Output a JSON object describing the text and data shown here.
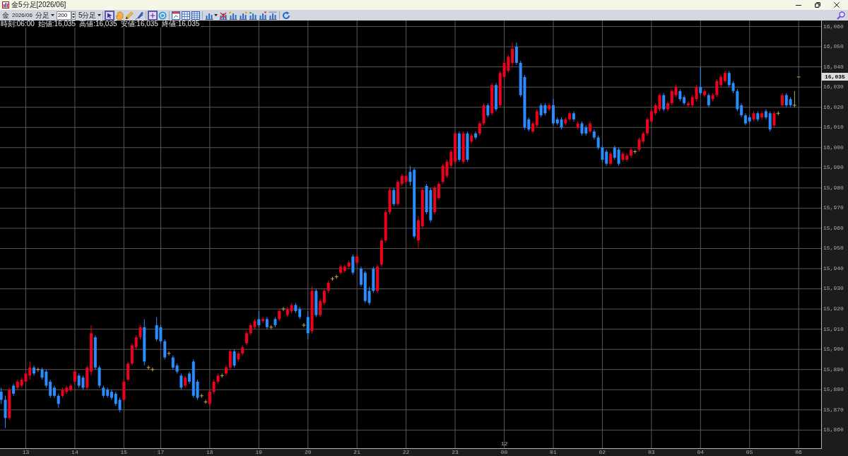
{
  "window": {
    "title": "金5分足[2026/06]"
  },
  "toolbar": {
    "symbol": "金",
    "contract": "2026/06",
    "bar_unit": "分足",
    "bar_count": "200",
    "period": "5分足",
    "tool_groups": [
      [
        {
          "kind": "pointer",
          "selected": true
        },
        {
          "kind": "hand",
          "selected": false
        },
        {
          "kind": "pencil",
          "selected": false
        },
        {
          "kind": "pen",
          "selected": false
        }
      ],
      [
        {
          "kind": "crosshair",
          "selected": true
        },
        {
          "kind": "disc",
          "selected": false
        }
      ],
      [
        {
          "kind": "window",
          "selected": false
        },
        {
          "kind": "table",
          "selected": false
        },
        {
          "kind": "grid",
          "selected": false
        }
      ],
      [
        {
          "kind": "barsmenu",
          "selected": false
        },
        {
          "kind": "barsdelete",
          "selected": false
        },
        {
          "kind": "barsleft",
          "selected": false
        },
        {
          "kind": "barsright",
          "selected": false
        },
        {
          "kind": "barsup",
          "selected": false
        },
        {
          "kind": "barsdown",
          "selected": false
        },
        {
          "kind": "barswide",
          "selected": false
        }
      ],
      [
        {
          "kind": "refresh",
          "selected": false
        }
      ]
    ]
  },
  "chart": {
    "readout": [
      "時刻:06:00",
      "始値:16,035",
      "高値:16,035",
      "安値:16,035",
      "終値:16,035"
    ],
    "current_price": "16,035",
    "chart_data": {
      "type": "candlestick",
      "grid": true,
      "categories": [
        null,
        null,
        null,
        null,
        null,
        null,
        "13",
        null,
        null,
        null,
        null,
        null,
        null,
        null,
        null,
        null,
        null,
        null,
        "14",
        null,
        null,
        null,
        null,
        null,
        null,
        null,
        null,
        null,
        null,
        null,
        "15",
        null,
        null,
        null,
        null,
        null,
        null,
        null,
        null,
        "17",
        null,
        null,
        null,
        null,
        null,
        null,
        null,
        null,
        null,
        null,
        null,
        "18",
        null,
        null,
        null,
        null,
        null,
        null,
        null,
        null,
        null,
        null,
        null,
        "19",
        null,
        null,
        null,
        null,
        null,
        null,
        null,
        null,
        null,
        null,
        null,
        "20",
        null,
        null,
        null,
        null,
        null,
        null,
        null,
        null,
        null,
        null,
        null,
        "21",
        null,
        null,
        null,
        null,
        null,
        null,
        null,
        null,
        null,
        null,
        null,
        "22",
        null,
        null,
        null,
        null,
        null,
        null,
        null,
        null,
        null,
        null,
        null,
        "23",
        null,
        null,
        null,
        null,
        null,
        null,
        null,
        null,
        null,
        null,
        null,
        "00",
        null,
        null,
        null,
        null,
        null,
        null,
        null,
        null,
        null,
        null,
        null,
        "01",
        null,
        null,
        null,
        null,
        null,
        null,
        null,
        null,
        null,
        null,
        null,
        "02",
        null,
        null,
        null,
        null,
        null,
        null,
        null,
        null,
        null,
        null,
        null,
        "03",
        null,
        null,
        null,
        null,
        null,
        null,
        null,
        null,
        null,
        null,
        null,
        "04",
        null,
        null,
        null,
        null,
        null,
        null,
        null,
        null,
        null,
        null,
        null,
        "05",
        null,
        null,
        null,
        null,
        null,
        null,
        null,
        null,
        null,
        null,
        null,
        "06"
      ],
      "ohlc": [
        [
          15879,
          15881,
          15873,
          15875
        ],
        [
          15875,
          15877,
          15861,
          15866
        ],
        [
          15866,
          15881,
          15865,
          15880
        ],
        [
          15882,
          15883,
          15877,
          15878
        ],
        [
          15881,
          15885,
          15880,
          15884
        ],
        [
          15882,
          15886,
          15881,
          15885
        ],
        [
          15884,
          15889,
          15883,
          15888
        ],
        [
          15887,
          15894,
          15885,
          15891
        ],
        [
          15891,
          15892,
          15887,
          15888
        ],
        [
          15890,
          15891,
          15889,
          15890
        ],
        [
          15890,
          15891,
          15885,
          15886
        ],
        [
          15889,
          15890,
          15881,
          15882
        ],
        [
          15884,
          15885,
          15876,
          15877
        ],
        [
          15881,
          15882,
          15876,
          15877
        ],
        [
          15877,
          15878,
          15871,
          15873
        ],
        [
          15877,
          15881,
          15876,
          15880
        ],
        [
          15879,
          15882,
          15878,
          15881
        ],
        [
          15880,
          15883,
          15879,
          15882
        ],
        [
          15884,
          15890,
          15883,
          15889
        ],
        [
          15887,
          15888,
          15881,
          15882
        ],
        [
          15886,
          15887,
          15880,
          15881
        ],
        [
          15881,
          15892,
          15880,
          15891
        ],
        [
          15889,
          15912,
          15887,
          15908
        ],
        [
          15906,
          15907,
          15890,
          15891
        ],
        [
          15891,
          15892,
          15881,
          15882
        ],
        [
          15881,
          15882,
          15876,
          15877
        ],
        [
          15880,
          15881,
          15876,
          15877
        ],
        [
          15879,
          15880,
          15875,
          15876
        ],
        [
          15878,
          15879,
          15872,
          15873
        ],
        [
          15875,
          15876,
          15869,
          15870
        ],
        [
          15875,
          15885,
          15874,
          15884
        ],
        [
          15885,
          15894,
          15884,
          15893
        ],
        [
          15893,
          15903,
          15892,
          15902
        ],
        [
          15901,
          15907,
          15900,
          15906
        ],
        [
          15906,
          15912,
          15905,
          15911
        ],
        [
          15911,
          15915,
          15892,
          15894
        ],
        [
          15891,
          15892,
          15890,
          15891
        ],
        [
          15890,
          15891,
          15889,
          15890
        ],
        [
          15912,
          15916,
          15904,
          15905
        ],
        [
          15911,
          15912,
          15903,
          15904
        ],
        [
          15904,
          15905,
          15895,
          15896
        ],
        [
          15898,
          15899,
          15897,
          15898
        ],
        [
          15896,
          15897,
          15890,
          15891
        ],
        [
          15892,
          15893,
          15888,
          15889
        ],
        [
          15887,
          15888,
          15880,
          15881
        ],
        [
          15882,
          15887,
          15881,
          15886
        ],
        [
          15888,
          15889,
          15883,
          15884
        ],
        [
          15894,
          15895,
          15876,
          15877
        ],
        [
          15884,
          15885,
          15875,
          15876
        ],
        [
          15877,
          15878,
          15876,
          15877
        ],
        [
          15874,
          15875,
          15873,
          15874
        ],
        [
          15873,
          15880,
          15872,
          15879
        ],
        [
          15879,
          15885,
          15878,
          15884
        ],
        [
          15884,
          15888,
          15883,
          15887
        ],
        [
          15887,
          15888,
          15886,
          15887
        ],
        [
          15888,
          15892,
          15887,
          15891
        ],
        [
          15891,
          15900,
          15890,
          15899
        ],
        [
          15899,
          15900,
          15891,
          15892
        ],
        [
          15895,
          15899,
          15894,
          15898
        ],
        [
          15898,
          15902,
          15897,
          15901
        ],
        [
          15903,
          15909,
          15902,
          15908
        ],
        [
          15908,
          15913,
          15907,
          15912
        ],
        [
          15911,
          15915,
          15910,
          15914
        ],
        [
          15915,
          15919,
          15911,
          15912
        ],
        [
          15914,
          15916,
          15913,
          15915
        ],
        [
          15915,
          15916,
          15910,
          15911
        ],
        [
          15911,
          15912,
          15910,
          15911
        ],
        [
          15915,
          15916,
          15911,
          15912
        ],
        [
          15915,
          15920,
          15914,
          15919
        ],
        [
          15920,
          15921,
          15919,
          15920
        ],
        [
          15917,
          15921,
          15916,
          15920
        ],
        [
          15919,
          15923,
          15918,
          15922
        ],
        [
          15922,
          15923,
          15918,
          15919
        ],
        [
          15920,
          15921,
          15915,
          15916
        ],
        [
          15912,
          15913,
          15911,
          15912
        ],
        [
          15916,
          15919,
          15905,
          15908
        ],
        [
          15909,
          15931,
          15908,
          15929
        ],
        [
          15929,
          15930,
          15916,
          15917
        ],
        [
          15917,
          15925,
          15916,
          15924
        ],
        [
          15923,
          15930,
          15922,
          15929
        ],
        [
          15929,
          15934,
          15928,
          15933
        ],
        [
          15935,
          15936,
          15934,
          15935
        ],
        [
          15936,
          15937,
          15935,
          15936
        ],
        [
          15938,
          15942,
          15937,
          15941
        ],
        [
          15939,
          15942,
          15938,
          15941
        ],
        [
          15941,
          15944,
          15940,
          15943
        ],
        [
          15946,
          15947,
          15937,
          15938
        ],
        [
          15943,
          15947,
          15942,
          15946
        ],
        [
          15940,
          15941,
          15931,
          15932
        ],
        [
          15938,
          15939,
          15923,
          15924
        ],
        [
          15929,
          15931,
          15922,
          15923
        ],
        [
          15940,
          15941,
          15928,
          15929
        ],
        [
          15929,
          15942,
          15928,
          15941
        ],
        [
          15942,
          15955,
          15941,
          15954
        ],
        [
          15954,
          15969,
          15953,
          15968
        ],
        [
          15968,
          15980,
          15967,
          15979
        ],
        [
          15979,
          15980,
          15971,
          15972
        ],
        [
          15972,
          15984,
          15971,
          15983
        ],
        [
          15982,
          15987,
          15981,
          15986
        ],
        [
          15983,
          15987,
          15982,
          15986
        ],
        [
          15988,
          15991,
          15981,
          15983
        ],
        [
          15989,
          15990,
          15955,
          15956
        ],
        [
          15954,
          15966,
          15950,
          15964
        ],
        [
          15961,
          15980,
          15960,
          15979
        ],
        [
          15981,
          15982,
          15967,
          15968
        ],
        [
          15979,
          15980,
          15963,
          15964
        ],
        [
          15968,
          15981,
          15967,
          15980
        ],
        [
          15975,
          15983,
          15974,
          15982
        ],
        [
          15983,
          15992,
          15982,
          15991
        ],
        [
          15986,
          15994,
          15985,
          15993
        ],
        [
          15991,
          15999,
          15990,
          15998
        ],
        [
          15993,
          16008,
          15992,
          16007
        ],
        [
          16007,
          16008,
          15993,
          15994
        ],
        [
          15993,
          16008,
          15992,
          16007
        ],
        [
          16007,
          16008,
          15993,
          15994
        ],
        [
          16003,
          16007,
          16002,
          16006
        ],
        [
          16007,
          16008,
          16004,
          16005
        ],
        [
          16007,
          16013,
          16006,
          16012
        ],
        [
          16012,
          16022,
          16011,
          16021
        ],
        [
          16021,
          16022,
          16015,
          16016
        ],
        [
          16017,
          16032,
          16016,
          16031
        ],
        [
          16031,
          16032,
          16018,
          16019
        ],
        [
          16021,
          16038,
          16020,
          16037
        ],
        [
          16035,
          16043,
          16034,
          16042
        ],
        [
          16038,
          16046,
          16037,
          16045
        ],
        [
          16042,
          16052,
          16040,
          16049
        ],
        [
          16050,
          16052,
          16041,
          16042
        ],
        [
          16042,
          16043,
          16025,
          16026
        ],
        [
          16035,
          16036,
          16009,
          16010
        ],
        [
          16014,
          16015,
          16008,
          16009
        ],
        [
          16008,
          16013,
          16007,
          16012
        ],
        [
          16011,
          16019,
          16010,
          16018
        ],
        [
          16021,
          16022,
          16015,
          16016
        ],
        [
          16021,
          16022,
          16016,
          16017
        ],
        [
          16019,
          16022,
          16018,
          16021
        ],
        [
          16021,
          16024,
          16011,
          16012
        ],
        [
          16014,
          16015,
          16011,
          16012
        ],
        [
          16014,
          16015,
          16009,
          16010
        ],
        [
          16012,
          16015,
          16011,
          16014
        ],
        [
          16014,
          16018,
          16013,
          16017
        ],
        [
          16017,
          16018,
          16013,
          16014
        ],
        [
          16010,
          16013,
          16009,
          16012
        ],
        [
          16012,
          16013,
          16006,
          16007
        ],
        [
          16010,
          16011,
          16006,
          16007
        ],
        [
          16008,
          16013,
          16007,
          16012
        ],
        [
          16008,
          16009,
          16004,
          16005
        ],
        [
          16005,
          16006,
          15999,
          16000
        ],
        [
          16000,
          16001,
          15993,
          15994
        ],
        [
          15998,
          15999,
          15991,
          15992
        ],
        [
          15992,
          15998,
          15991,
          15997
        ],
        [
          16000,
          16001,
          15994,
          15995
        ],
        [
          15999,
          16000,
          15991,
          15992
        ],
        [
          15994,
          15998,
          15993,
          15997
        ],
        [
          15994,
          15997,
          15993,
          15996
        ],
        [
          15996,
          16000,
          15995,
          15999
        ],
        [
          15998,
          15999,
          15997,
          15998
        ],
        [
          15999,
          16005,
          15998,
          16004
        ],
        [
          16003,
          16008,
          16002,
          16007
        ],
        [
          16007,
          16015,
          16006,
          16014
        ],
        [
          16013,
          16019,
          16012,
          16018
        ],
        [
          16017,
          16022,
          16016,
          16021
        ],
        [
          16019,
          16027,
          16018,
          16026
        ],
        [
          16026,
          16027,
          16018,
          16019
        ],
        [
          16019,
          16023,
          16018,
          16022
        ],
        [
          16022,
          16029,
          16021,
          16028
        ],
        [
          16026,
          16031,
          16025,
          16030
        ],
        [
          16028,
          16029,
          16023,
          16024
        ],
        [
          16025,
          16026,
          16021,
          16022
        ],
        [
          16021,
          16023,
          16020,
          16022
        ],
        [
          16021,
          16026,
          16020,
          16025
        ],
        [
          16024,
          16031,
          16023,
          16030
        ],
        [
          16030,
          16040,
          16026,
          16027
        ],
        [
          16026,
          16029,
          16025,
          16028
        ],
        [
          16026,
          16027,
          16020,
          16021
        ],
        [
          16024,
          16027,
          16023,
          16026
        ],
        [
          16026,
          16034,
          16025,
          16033
        ],
        [
          16031,
          16036,
          16030,
          16035
        ],
        [
          16033,
          16038,
          16032,
          16037
        ],
        [
          16037,
          16038,
          16030,
          16031
        ],
        [
          16032,
          16033,
          16027,
          16028
        ],
        [
          16028,
          16029,
          16018,
          16019
        ],
        [
          16021,
          16022,
          16015,
          16016
        ],
        [
          16016,
          16017,
          16011,
          16012
        ],
        [
          16015,
          16016,
          16012,
          16013
        ],
        [
          16014,
          16018,
          16013,
          16017
        ],
        [
          16017,
          16018,
          16013,
          16014
        ],
        [
          16015,
          16018,
          16014,
          16017
        ],
        [
          16018,
          16019,
          16014,
          16015
        ],
        [
          16017,
          16018,
          16008,
          16009
        ],
        [
          16011,
          16018,
          16010,
          16017
        ],
        [
          16017,
          16018,
          16016,
          16017
        ],
        [
          16021,
          16027,
          16020,
          16026
        ],
        [
          16026,
          16027,
          16020,
          16021
        ],
        [
          16024,
          16025,
          16020,
          16021
        ],
        [
          16021,
          16028,
          16020,
          16021
        ],
        [
          16035,
          16035,
          16035,
          16035
        ]
      ],
      "ylim": [
        15851,
        16063
      ],
      "yticks": [
        {
          "value": 16060,
          "label": "16,060"
        },
        {
          "value": 16050,
          "label": "16,050"
        },
        {
          "value": 16040,
          "label": "16,040"
        },
        {
          "value": 16030,
          "label": "16,030"
        },
        {
          "value": 16020,
          "label": "16,020"
        },
        {
          "value": 16010,
          "label": "16,010"
        },
        {
          "value": 16000,
          "label": "16,000"
        },
        {
          "value": 15990,
          "label": "15,990"
        },
        {
          "value": 15980,
          "label": "15,980"
        },
        {
          "value": 15970,
          "label": "15,970"
        },
        {
          "value": 15960,
          "label": "15,960"
        },
        {
          "value": 15950,
          "label": "15,950"
        },
        {
          "value": 15940,
          "label": "15,940"
        },
        {
          "value": 15930,
          "label": "15,930"
        },
        {
          "value": 15920,
          "label": "15,920"
        },
        {
          "value": 15910,
          "label": "15,910"
        },
        {
          "value": 15900,
          "label": "15,900"
        },
        {
          "value": 15890,
          "label": "15,890"
        },
        {
          "value": 15880,
          "label": "15,880"
        },
        {
          "value": 15870,
          "label": "15,870"
        },
        {
          "value": 15860,
          "label": "15,860"
        }
      ],
      "annotations": [
        "12"
      ]
    }
  }
}
